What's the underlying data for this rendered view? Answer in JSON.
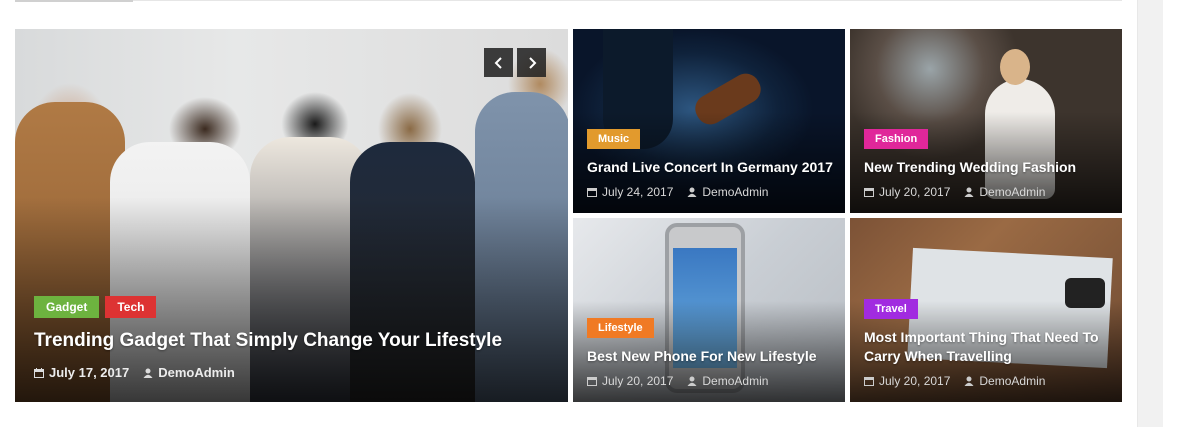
{
  "slider": {
    "prev_label": "‹",
    "next_label": "›"
  },
  "hero": {
    "categories": [
      {
        "label": "Gadget",
        "color": "#6db33f"
      },
      {
        "label": "Tech",
        "color": "#dd3333"
      }
    ],
    "title": "Trending Gadget That Simply Change Your Lifestyle",
    "date": "July 17, 2017",
    "author": "DemoAdmin"
  },
  "posts": [
    {
      "category": "Music",
      "category_color": "#e29a2d",
      "title": "Grand Live Concert In Germany 2017",
      "date": "July 24, 2017",
      "author": "DemoAdmin"
    },
    {
      "category": "Fashion",
      "category_color": "#e0279a",
      "title": "New Trending Wedding Fashion",
      "date": "July 20, 2017",
      "author": "DemoAdmin"
    },
    {
      "category": "Lifestyle",
      "category_color": "#f07a24",
      "title": "Best New Phone For New Lifestyle",
      "date": "July 20, 2017",
      "author": "DemoAdmin"
    },
    {
      "category": "Travel",
      "category_color": "#a12be0",
      "title": "Most Important Thing That Need To Carry When Travelling",
      "date": "July 20, 2017",
      "author": "DemoAdmin"
    }
  ],
  "icons": {
    "date": "calendar-icon",
    "author": "user-icon",
    "prev": "chevron-left-icon",
    "next": "chevron-right-icon"
  }
}
